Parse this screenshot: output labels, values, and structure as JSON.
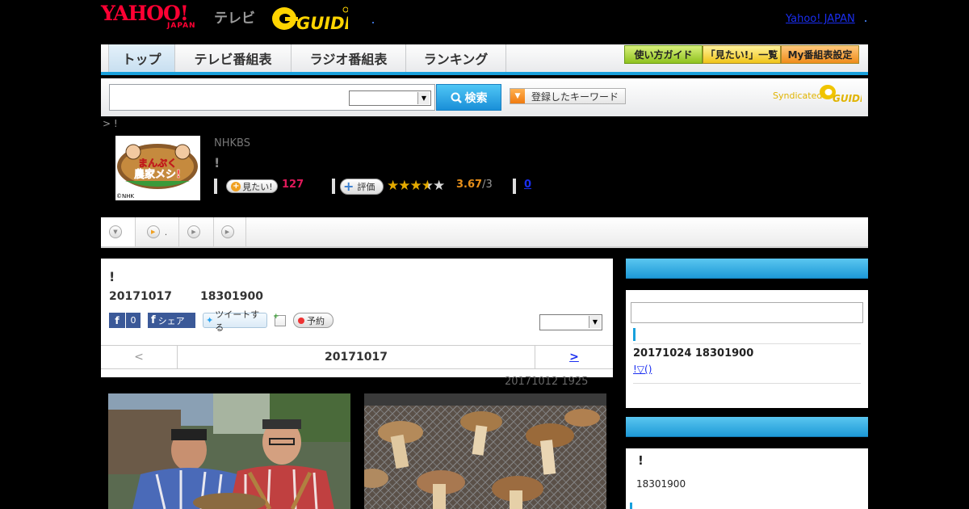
{
  "header": {
    "logo_yahoo": "YAHOO!",
    "logo_japan": "JAPAN",
    "logo_tv": "テレビ",
    "logo_gguide": "G-GUIDE",
    "yahoo_japan_link": "Yahoo! JAPAN"
  },
  "nav": {
    "tabs": [
      {
        "label": "トップ"
      },
      {
        "label": "テレビ番組表"
      },
      {
        "label": "ラジオ番組表"
      },
      {
        "label": "ランキング"
      }
    ],
    "buttons": [
      {
        "label": "使い方ガイド"
      },
      {
        "label": "「見たい!」一覧"
      },
      {
        "label": "My番組表設定"
      }
    ]
  },
  "search": {
    "input_value": "",
    "select_value": "",
    "button_label": "検索",
    "keyword_button_label": "登録したキーワード",
    "syndicated_label": "Syndicated",
    "syndicated_logo": "G-GUIDE"
  },
  "breadcrumb": "> !",
  "program": {
    "thumb_title": "まんぷく農家メシ!",
    "thumb_credit": "©NHK",
    "channel": "NHKBS",
    "title": "!",
    "mitai_label": "見たい!",
    "mitai_count": "127",
    "hyoka_label": "評価",
    "rating": 3.67,
    "score": "3.67",
    "score_total": "/3",
    "review_count": "0"
  },
  "subtabs": [
    {
      "label": ""
    },
    {
      "label": "."
    },
    {
      "label": ""
    },
    {
      "label": ""
    }
  ],
  "main": {
    "title": "!",
    "date": "20171017",
    "time": "18301900",
    "fb_like_count": "0",
    "fb_share_label": "シェア",
    "tweet_label": "ツイートする",
    "reserve_label": "予約",
    "select_value": "",
    "prev_label": "<",
    "nav_date": "20171017",
    "next_label": ">",
    "prev_air": "20171012  1925"
  },
  "sidebar": {
    "box1": {
      "input_value": "",
      "date": "20171024  18301900",
      "link": "!▽()"
    },
    "box2": {
      "title": "!",
      "time": "18301900"
    }
  },
  "colors": {
    "accent_blue": "#18a0dc",
    "yahoo_red": "#ff0033",
    "mitai_pink": "#e0195a",
    "star_gold": "#e4aa00",
    "link_blue": "#1a2ef0",
    "facebook_blue": "#3b5998"
  }
}
